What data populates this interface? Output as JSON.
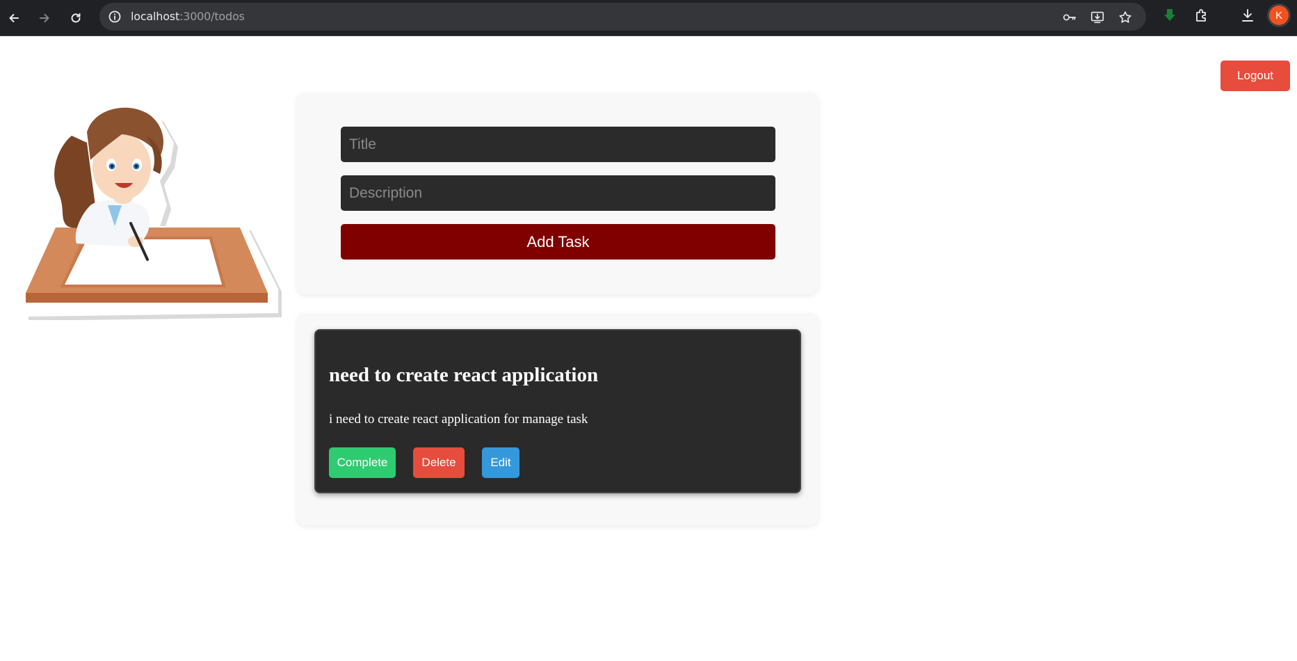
{
  "browser": {
    "url_host": "localhost",
    "url_path": ":3000/todos",
    "profile_initial": "K"
  },
  "header": {
    "logout_label": "Logout"
  },
  "form": {
    "title_placeholder": "Title",
    "description_placeholder": "Description",
    "add_label": "Add Task"
  },
  "tasks": [
    {
      "title": "need to create react application",
      "description": "i need to create react application for manage task",
      "complete_label": "Complete",
      "delete_label": "Delete",
      "edit_label": "Edit"
    }
  ],
  "colors": {
    "logout": "#e74c3c",
    "add_task": "#800000",
    "complete": "#2ecc71",
    "delete": "#e74c3c",
    "edit": "#3498db"
  },
  "icons": [
    "back-arrow-icon",
    "forward-arrow-icon",
    "reload-icon",
    "site-info-icon",
    "password-key-icon",
    "install-app-icon",
    "bookmark-star-icon",
    "green-download-arrow-icon",
    "extensions-puzzle-icon",
    "downloads-icon",
    "profile-avatar"
  ]
}
